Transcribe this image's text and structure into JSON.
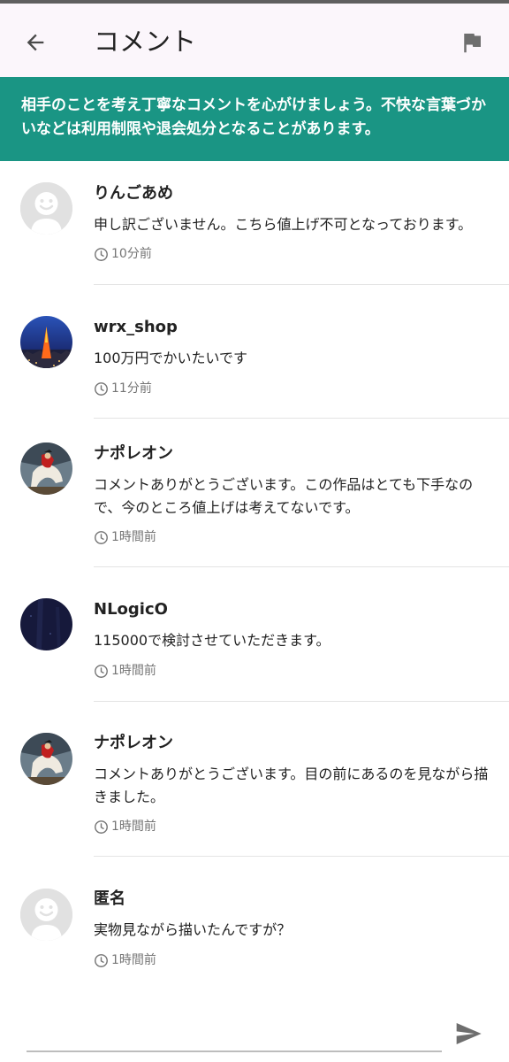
{
  "header": {
    "title": "コメント",
    "back_icon": "arrow-left-icon",
    "report_icon": "flag-icon"
  },
  "notice": {
    "text": "相手のことを考え丁寧なコメントを心がけましょう。不快な言葉づかいなどは利用制限や退会処分となることがあります。",
    "background_color": "#1a9584"
  },
  "comments": [
    {
      "user": "りんごあめ",
      "text": "申し訳ございません。こちら値上げ不可となっております。",
      "time": "10分前",
      "avatar": "default-avatar"
    },
    {
      "user": "wrx_shop",
      "text": "100万円でかいたいです",
      "time": "11分前",
      "avatar": "tokyo-tower-night-photo"
    },
    {
      "user": "ナポレオン",
      "text": "コメントありがとうございます。この作品はとても下手なので、今のところ値上げは考えてないです。",
      "time": "1時間前",
      "avatar": "napoleon-painting"
    },
    {
      "user": "NLogicO",
      "text": "115000で検討させていただきます。",
      "time": "1時間前",
      "avatar": "dark-navy-image"
    },
    {
      "user": "ナポレオン",
      "text": "コメントありがとうございます。目の前にあるのを見ながら描きました。",
      "time": "1時間前",
      "avatar": "napoleon-painting"
    },
    {
      "user": "匿名",
      "text": "実物見ながら描いたんですが？",
      "time": "1時間前",
      "avatar": "default-avatar"
    }
  ],
  "composer": {
    "send_icon": "send-icon"
  }
}
